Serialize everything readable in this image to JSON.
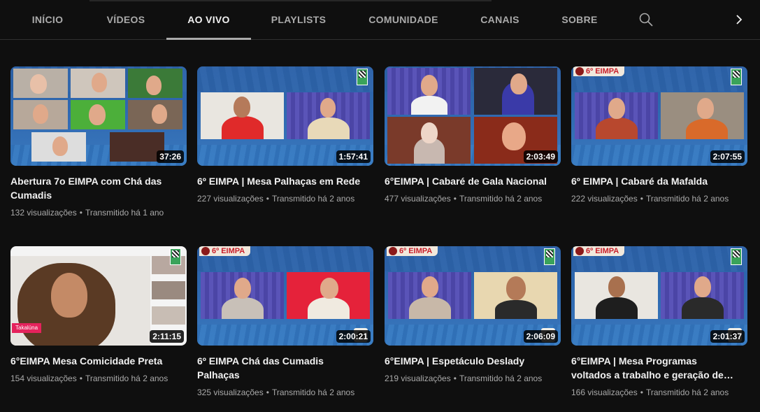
{
  "tabs": [
    {
      "label": "INÍCIO",
      "active": false
    },
    {
      "label": "VÍDEOS",
      "active": false
    },
    {
      "label": "AO VIVO",
      "active": true
    },
    {
      "label": "PLAYLISTS",
      "active": false
    },
    {
      "label": "COMUNIDADE",
      "active": false
    },
    {
      "label": "CANAIS",
      "active": false
    },
    {
      "label": "SOBRE",
      "active": false
    }
  ],
  "icons": {
    "search": "search-icon",
    "next": "chevron-right-icon"
  },
  "videos": [
    {
      "title": "Abertura 7o EIMPA com Chá das Cumadis",
      "views": "132 visualizações",
      "streamed": "Transmitido há 1 ano",
      "duration": "37:26"
    },
    {
      "title": "6º EIMPA | Mesa Palhaças em Rede",
      "views": "227 visualizações",
      "streamed": "Transmitido há 2 anos",
      "duration": "1:57:41"
    },
    {
      "title": "6°EIMPA | Cabaré de Gala Nacional",
      "views": "477 visualizações",
      "streamed": "Transmitido há 2 anos",
      "duration": "2:03:49"
    },
    {
      "title": "6º EIMPA | Cabaré da Mafalda",
      "views": "222 visualizações",
      "streamed": "Transmitido há 2 anos",
      "duration": "2:07:55",
      "badge": "6º EIMPA"
    },
    {
      "title": "6°EIMPA Mesa Comicidade Preta",
      "views": "154 visualizações",
      "streamed": "Transmitido há 2 anos",
      "duration": "2:11:15",
      "name_tag": "Takalúna"
    },
    {
      "title": "6º EIMPA Chá das Cumadis Palhaças",
      "views": "325 visualizações",
      "streamed": "Transmitido há 2 anos",
      "duration": "2:00:21",
      "badge": "6º EIMPA"
    },
    {
      "title": "6°EIMPA | Espetáculo Deslady",
      "views": "219 visualizações",
      "streamed": "Transmitido há 2 anos",
      "duration": "2:06:09",
      "badge": "6º EIMPA"
    },
    {
      "title": "6°EIMPA | Mesa Programas voltados a trabalho e geração de…",
      "views": "166 visualizações",
      "streamed": "Transmitido há 2 anos",
      "duration": "2:01:37",
      "badge": "6º EIMPA"
    }
  ],
  "colors": {
    "background": "#0f0f0f",
    "text": "#f1f1f1",
    "muted": "#aaaaaa",
    "thumb_blue": "#2f69b0"
  }
}
